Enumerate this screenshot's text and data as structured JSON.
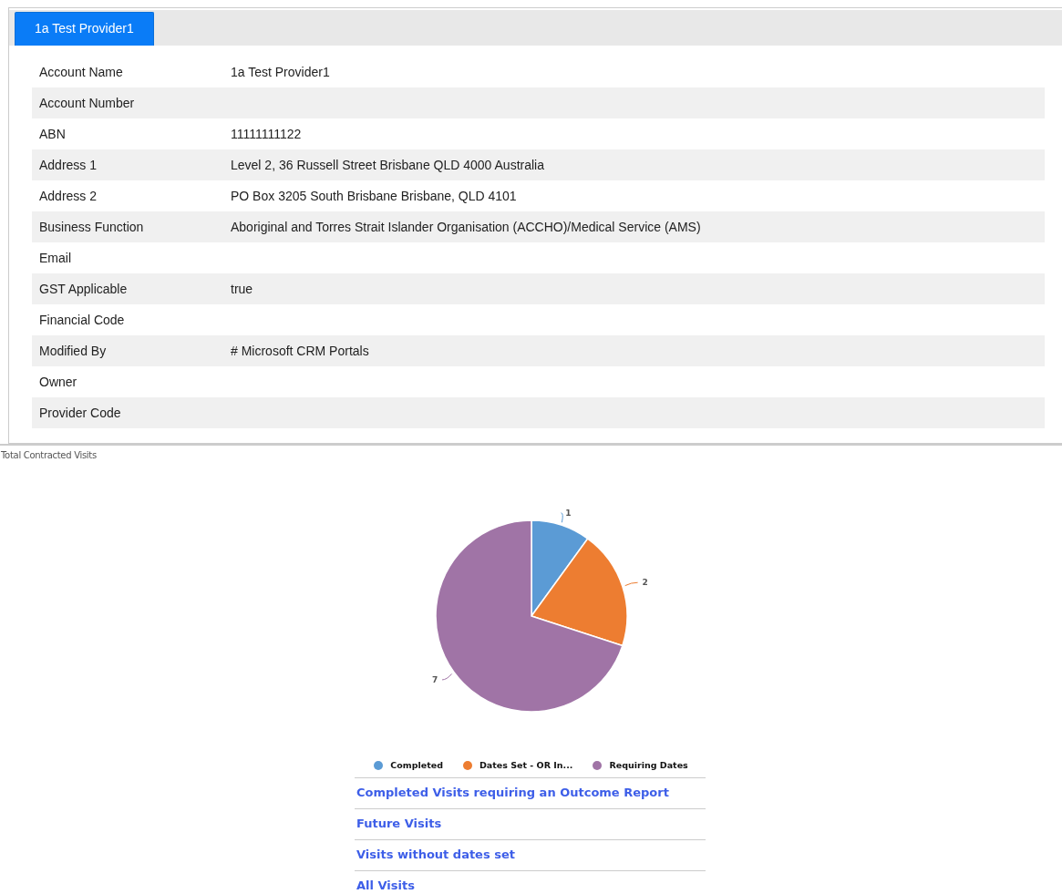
{
  "tabs": [
    {
      "label": "1a Test Provider1",
      "selected": true
    }
  ],
  "fields": [
    {
      "label": "Account Name",
      "value": "1a Test Provider1"
    },
    {
      "label": "Account Number"
    },
    {
      "label": "ABN",
      "value": "11111111122"
    },
    {
      "label": "Address 1",
      "value": "Level 2, 36 Russell Street Brisbane QLD 4000 Australia"
    },
    {
      "label": "Address 2",
      "value": "PO Box 3205 South Brisbane Brisbane, QLD 4101"
    },
    {
      "label": "Business Function",
      "value": "Aboriginal and Torres Strait Islander Organisation (ACCHO)/Medical Service (AMS)"
    },
    {
      "label": "Email"
    },
    {
      "label": "GST Applicable",
      "value": "true"
    },
    {
      "label": "Financial Code"
    },
    {
      "label": "Modified By",
      "value": "# Microsoft CRM Portals"
    },
    {
      "label": "Owner"
    },
    {
      "label": "Provider Code"
    }
  ],
  "chart": {
    "title": "Total Contracted Visits",
    "chart_data": {
      "type": "pie",
      "categories": [
        "Completed",
        "Dates Set - OR In...",
        "Requiring Dates"
      ],
      "values": [
        1,
        2,
        7
      ],
      "data_labels": true
    },
    "legend": [
      {
        "color": "#5b9bd5"
      },
      {
        "color": "#ed7d31"
      },
      {
        "color": "#a074a6"
      }
    ]
  },
  "links": [
    "Completed Visits requiring an Outcome Report",
    "Future Visits",
    "Visits without dates set",
    "All Visits"
  ]
}
